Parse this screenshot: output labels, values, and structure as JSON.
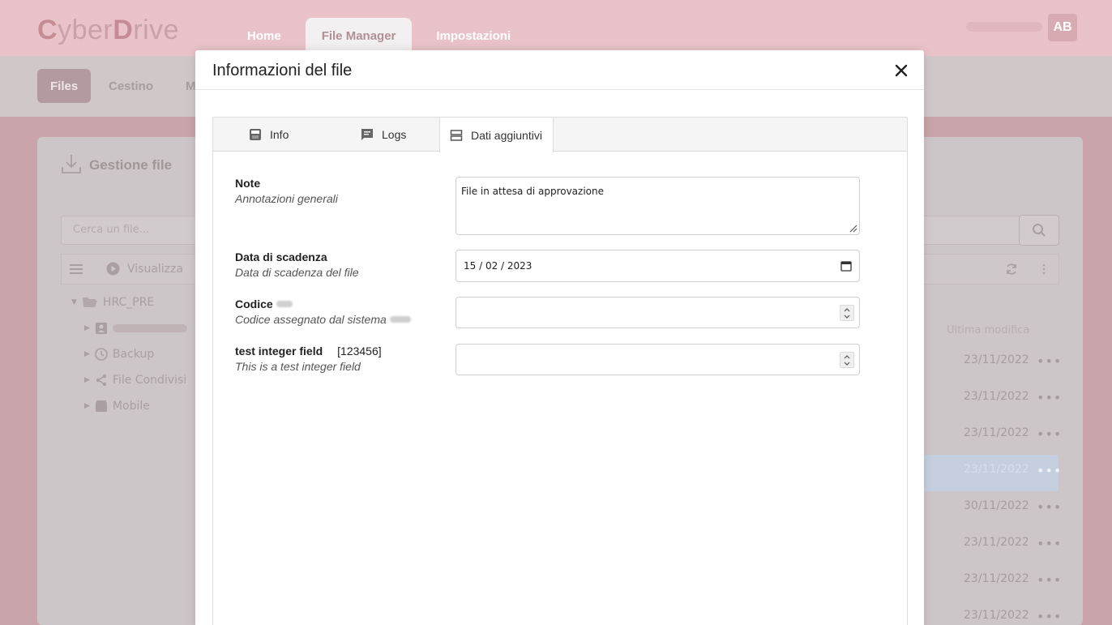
{
  "app": {
    "logo_c": "C",
    "logo_yber": "yber",
    "logo_d": "D",
    "logo_rive": "rive",
    "nav": [
      "Home",
      "File Manager",
      "Impostazioni"
    ],
    "user_initials": "AB"
  },
  "subnav": [
    "Files",
    "Cestino",
    "M"
  ],
  "card": {
    "title": "Gestione file",
    "search_placeholder": "Cerca un file...",
    "toolbar_view": "Visualizza",
    "tree": [
      "HRC_PRE",
      "Backup",
      "File Condivisi",
      "Mobile"
    ],
    "column_header": "Ultima modifica",
    "dates": [
      "23/11/2022",
      "23/11/2022",
      "23/11/2022",
      "23/11/2022",
      "30/11/2022",
      "23/11/2022",
      "23/11/2022",
      "23/11/2022"
    ]
  },
  "modal": {
    "title": "Informazioni del file",
    "tabs": [
      {
        "label": "Info",
        "icon": "save-icon"
      },
      {
        "label": "Logs",
        "icon": "message-icon"
      },
      {
        "label": "Dati aggiuntivi",
        "icon": "storage-icon"
      }
    ],
    "active_tab": "Dati aggiuntivi",
    "fields": {
      "note": {
        "label": "Note",
        "desc": "Annotazioni generali",
        "value": "File in attesa di approvazione"
      },
      "expiry": {
        "label": "Data di scadenza",
        "desc": "Data di scadenza del file",
        "value": "15 / 02 / 2023"
      },
      "code": {
        "label": "Codice",
        "desc": "Codice assegnato dal sistema",
        "value": ""
      },
      "test_int": {
        "label": "test integer field",
        "hint": "[123456]",
        "desc": "This is a test integer field",
        "value": ""
      }
    }
  }
}
